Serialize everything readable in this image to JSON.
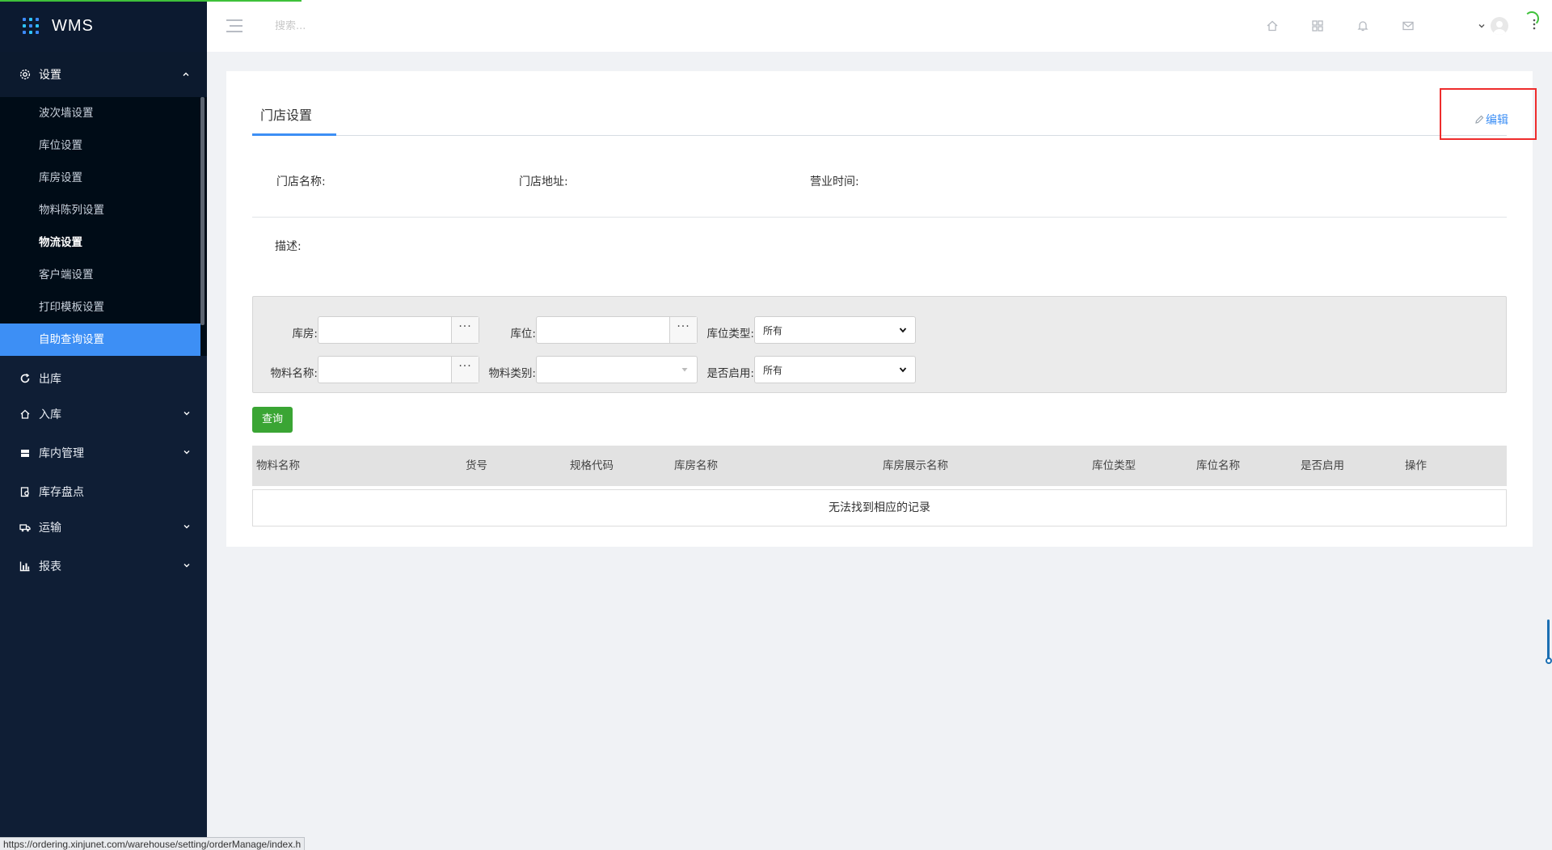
{
  "brand": {
    "name": "WMS"
  },
  "sidebar": {
    "section_settings": {
      "label": "设置"
    },
    "settings_items": [
      {
        "label": "波次墙设置"
      },
      {
        "label": "库位设置"
      },
      {
        "label": "库房设置"
      },
      {
        "label": "物料陈列设置"
      },
      {
        "label": "物流设置"
      },
      {
        "label": "客户端设置"
      },
      {
        "label": "打印模板设置"
      },
      {
        "label": "自助查询设置"
      }
    ],
    "items": [
      {
        "label": "出库"
      },
      {
        "label": "入库"
      },
      {
        "label": "库内管理"
      },
      {
        "label": "库存盘点"
      },
      {
        "label": "运输"
      },
      {
        "label": "报表"
      }
    ]
  },
  "header": {
    "search_placeholder": "搜索..."
  },
  "card": {
    "tab_label": "门店设置",
    "edit_label": "编辑",
    "store_name_label": "门店名称:",
    "store_address_label": "门店地址:",
    "hours_label": "营业时间:",
    "description_label": "描述:"
  },
  "filters": {
    "warehouse_label": "库房:",
    "location_label": "库位:",
    "location_type_label": "库位类型:",
    "location_type_value": "所有",
    "material_name_label": "物料名称:",
    "material_category_label": "物料类别:",
    "enabled_label": "是否启用:",
    "enabled_value": "所有",
    "picker_dots": "···"
  },
  "query_button": "查询",
  "table": {
    "columns": [
      "物料名称",
      "货号",
      "规格代码",
      "库房名称",
      "库房展示名称",
      "库位类型",
      "库位名称",
      "是否启用",
      "操作"
    ],
    "empty_text": "无法找到相应的记录"
  },
  "status_url": "https://ordering.xinjunet.com/warehouse/setting/orderManage/index.h",
  "colors": {
    "sidebar_bg": "#0f1e35",
    "active_menu": "#3d8ff5",
    "query_button": "#3aa534",
    "highlight_border": "#ee2c2c",
    "link": "#3d8ff5"
  }
}
